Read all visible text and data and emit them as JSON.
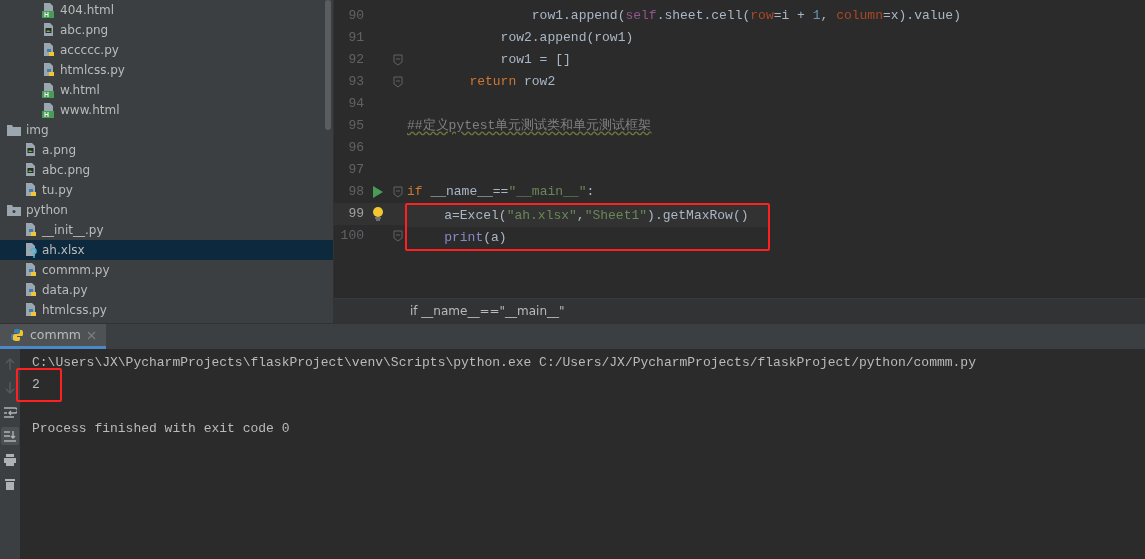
{
  "project_tree": [
    {
      "children": [
        {
          "children": [
            {
              "name": "404.html",
              "kind": "html",
              "selected": false
            },
            {
              "name": "abc.png",
              "kind": "image",
              "selected": false
            },
            {
              "name": "accccc.py",
              "kind": "python",
              "selected": false
            },
            {
              "name": "htmlcss.py",
              "kind": "python",
              "selected": false
            },
            {
              "name": "w.html",
              "kind": "html",
              "selected": false
            },
            {
              "name": "www.html",
              "kind": "html",
              "selected": false
            }
          ]
        }
      ]
    },
    {
      "name": "img",
      "kind": "folder",
      "selected": false,
      "children": [
        {
          "name": "a.png",
          "kind": "image",
          "selected": false
        },
        {
          "name": "abc.png",
          "kind": "image",
          "selected": false
        },
        {
          "name": "tu.py",
          "kind": "python",
          "selected": false
        }
      ]
    },
    {
      "name": "python",
      "kind": "package",
      "selected": false,
      "children": [
        {
          "name": "__init__.py",
          "kind": "python",
          "selected": false
        },
        {
          "name": "ah.xlsx",
          "kind": "unknown",
          "selected": true
        },
        {
          "name": "commm.py",
          "kind": "python",
          "selected": false
        },
        {
          "name": "data.py",
          "kind": "python",
          "selected": false
        },
        {
          "name": "htmlcss.py",
          "kind": "python",
          "selected": false
        }
      ]
    }
  ],
  "editor": {
    "lines": [
      {
        "number": "90",
        "tokens": [
          {
            "text": "                row1.append(",
            "kind": "plain"
          },
          {
            "text": "self",
            "kind": "self"
          },
          {
            "text": ".sheet.cell(",
            "kind": "plain"
          },
          {
            "text": "row",
            "kind": "param"
          },
          {
            "text": "=i + ",
            "kind": "plain"
          },
          {
            "text": "1",
            "kind": "number"
          },
          {
            "text": ", ",
            "kind": "plain"
          },
          {
            "text": "column",
            "kind": "param"
          },
          {
            "text": "=x).value)",
            "kind": "plain"
          }
        ]
      },
      {
        "number": "91",
        "tokens": [
          {
            "text": "            row2.append(row1)",
            "kind": "plain"
          }
        ]
      },
      {
        "number": "92",
        "fold": true,
        "tokens": [
          {
            "text": "            row1 = []",
            "kind": "plain"
          }
        ]
      },
      {
        "number": "93",
        "fold": true,
        "tokens": [
          {
            "text": "        return",
            "kind": "keyword"
          },
          {
            "text": " row2",
            "kind": "plain"
          }
        ]
      },
      {
        "number": "94"
      },
      {
        "number": "95",
        "tokens": [
          {
            "text": "##定义pytest单元测试类和单元测试框架",
            "kind": "comment"
          }
        ]
      },
      {
        "number": "96"
      },
      {
        "number": "97"
      },
      {
        "number": "98",
        "run": true,
        "fold": true,
        "tokens": [
          {
            "text": "if",
            "kind": "keyword"
          },
          {
            "text": " __name__==",
            "kind": "plain"
          },
          {
            "text": "\"__main__\"",
            "kind": "string"
          },
          {
            "text": ":",
            "kind": "plain"
          }
        ]
      },
      {
        "number": "99",
        "current": true,
        "bulb": true,
        "marked": true,
        "tokens": [
          {
            "text": "    a=Excel(",
            "kind": "plain"
          },
          {
            "text": "\"ah.xlsx\"",
            "kind": "string"
          },
          {
            "text": ",",
            "kind": "plain"
          },
          {
            "text": "\"Sheet1\"",
            "kind": "string"
          },
          {
            "text": ").getMaxRow()",
            "kind": "plain"
          }
        ]
      },
      {
        "number": "100",
        "fold": true,
        "marked": true,
        "tokens": [
          {
            "text": "    print",
            "kind": "builtin"
          },
          {
            "text": "(a)",
            "kind": "plain"
          }
        ]
      }
    ],
    "breadcrumb": "if __name__==\"__main__\""
  },
  "run_panel": {
    "tabs": [
      {
        "label": "commm",
        "selected": true
      }
    ],
    "toolbar": [
      {
        "kind": "up",
        "disabled": true
      },
      {
        "kind": "down",
        "disabled": true
      },
      {
        "kind": "wrap",
        "disabled": false
      },
      {
        "kind": "scroll-end",
        "disabled": false,
        "selected": true
      },
      {
        "kind": "print",
        "disabled": false
      },
      {
        "kind": "trash",
        "disabled": false
      }
    ],
    "output": [
      {
        "kind": "command",
        "text": "C:\\Users\\JX\\PycharmProjects\\flaskProject\\venv\\Scripts\\python.exe C:/Users/JX/PycharmProjects/flaskProject/python/commm.py",
        "marked": false
      },
      {
        "kind": "stdout",
        "text": "2",
        "marked": true
      },
      {
        "kind": "exit",
        "text": "Process finished with exit code 0",
        "marked": false
      }
    ]
  }
}
